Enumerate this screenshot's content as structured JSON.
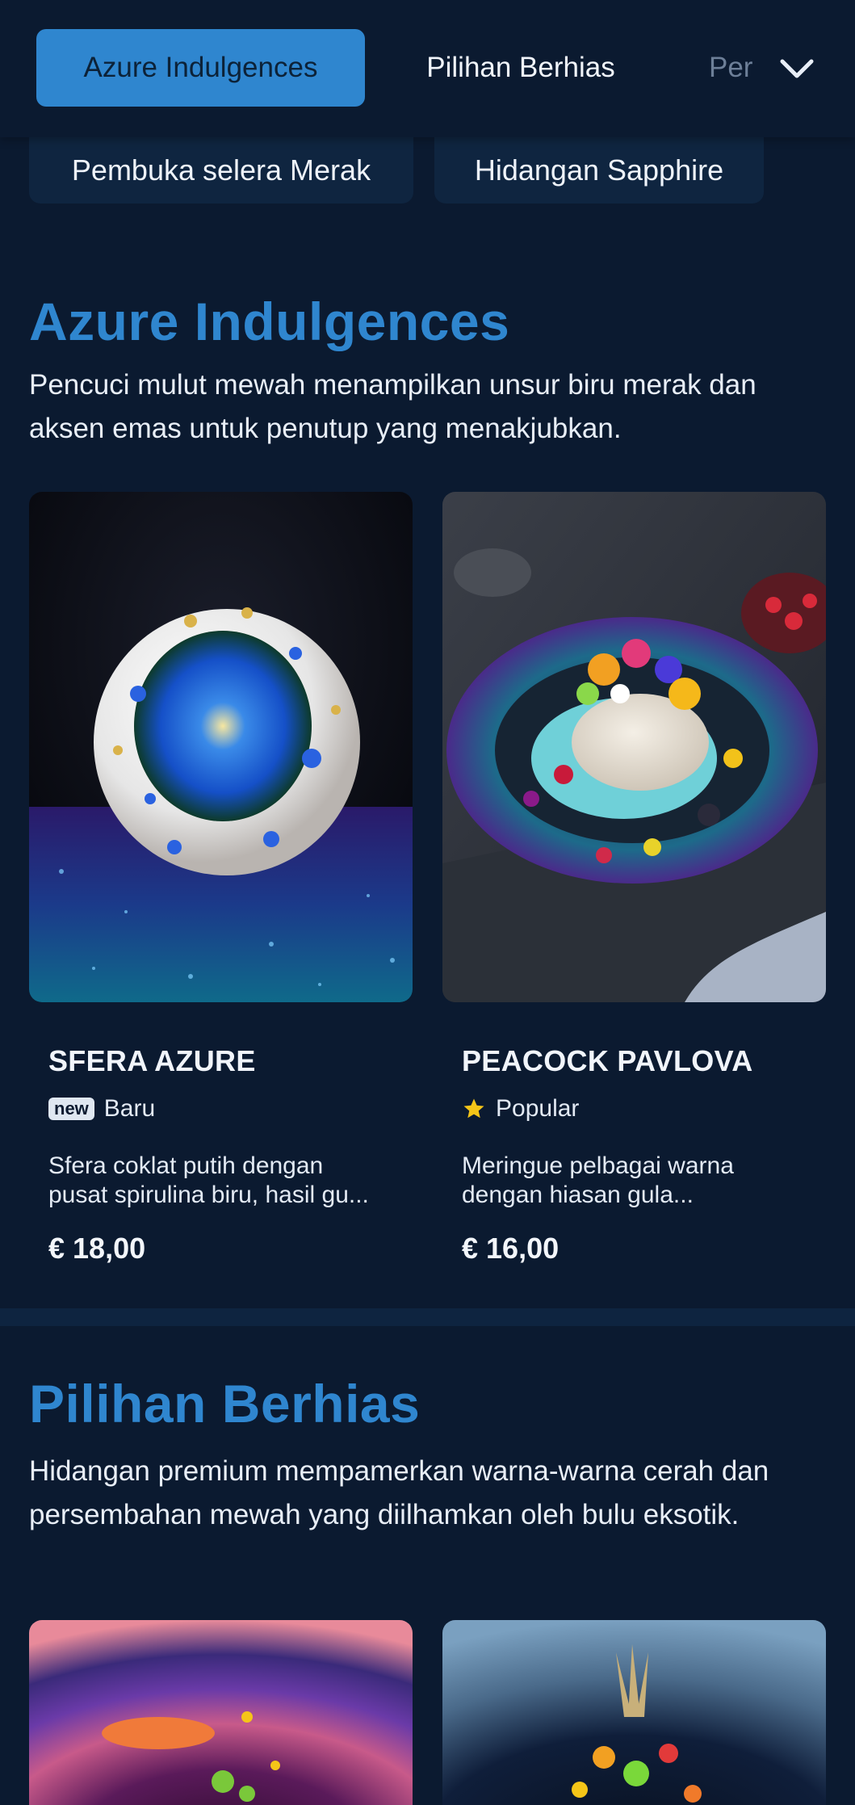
{
  "nav": {
    "tabs": [
      {
        "label": "Azure Indulgences",
        "active": true
      },
      {
        "label": "Pilihan Berhias"
      },
      {
        "label": "Per"
      }
    ],
    "more_icon": "chevron-down-icon",
    "subchips": [
      {
        "label": "Pembuka selera Merak"
      },
      {
        "label": "Hidangan Sapphire"
      }
    ]
  },
  "sections": [
    {
      "title": "Azure Indulgences",
      "description": "Pencuci mulut mewah menampilkan unsur biru merak dan aksen emas untuk penutup yang menakjubkan.",
      "items": [
        {
          "name": "SFERA AZURE",
          "badge_icon": "new",
          "badge_label": "Baru",
          "description_line1": "Sfera coklat putih dengan",
          "description_line2": "pusat spirulina biru, hasil gu...",
          "price": "€ 18,00"
        },
        {
          "name": "PEACOCK PAVLOVA",
          "badge_icon": "star-icon",
          "badge_label": "Popular",
          "description_line1": "Meringue pelbagai warna",
          "description_line2": "dengan hiasan gula...",
          "price": "€ 16,00"
        }
      ]
    },
    {
      "title": "Pilihan Berhias",
      "description": "Hidangan premium mempamerkan warna-warna cerah dan persembahan mewah yang diilhamkan oleh bulu eksotik."
    }
  ],
  "colors": {
    "background": "#0b1a30",
    "accent": "#2f86cf",
    "star": "#f5c518"
  }
}
